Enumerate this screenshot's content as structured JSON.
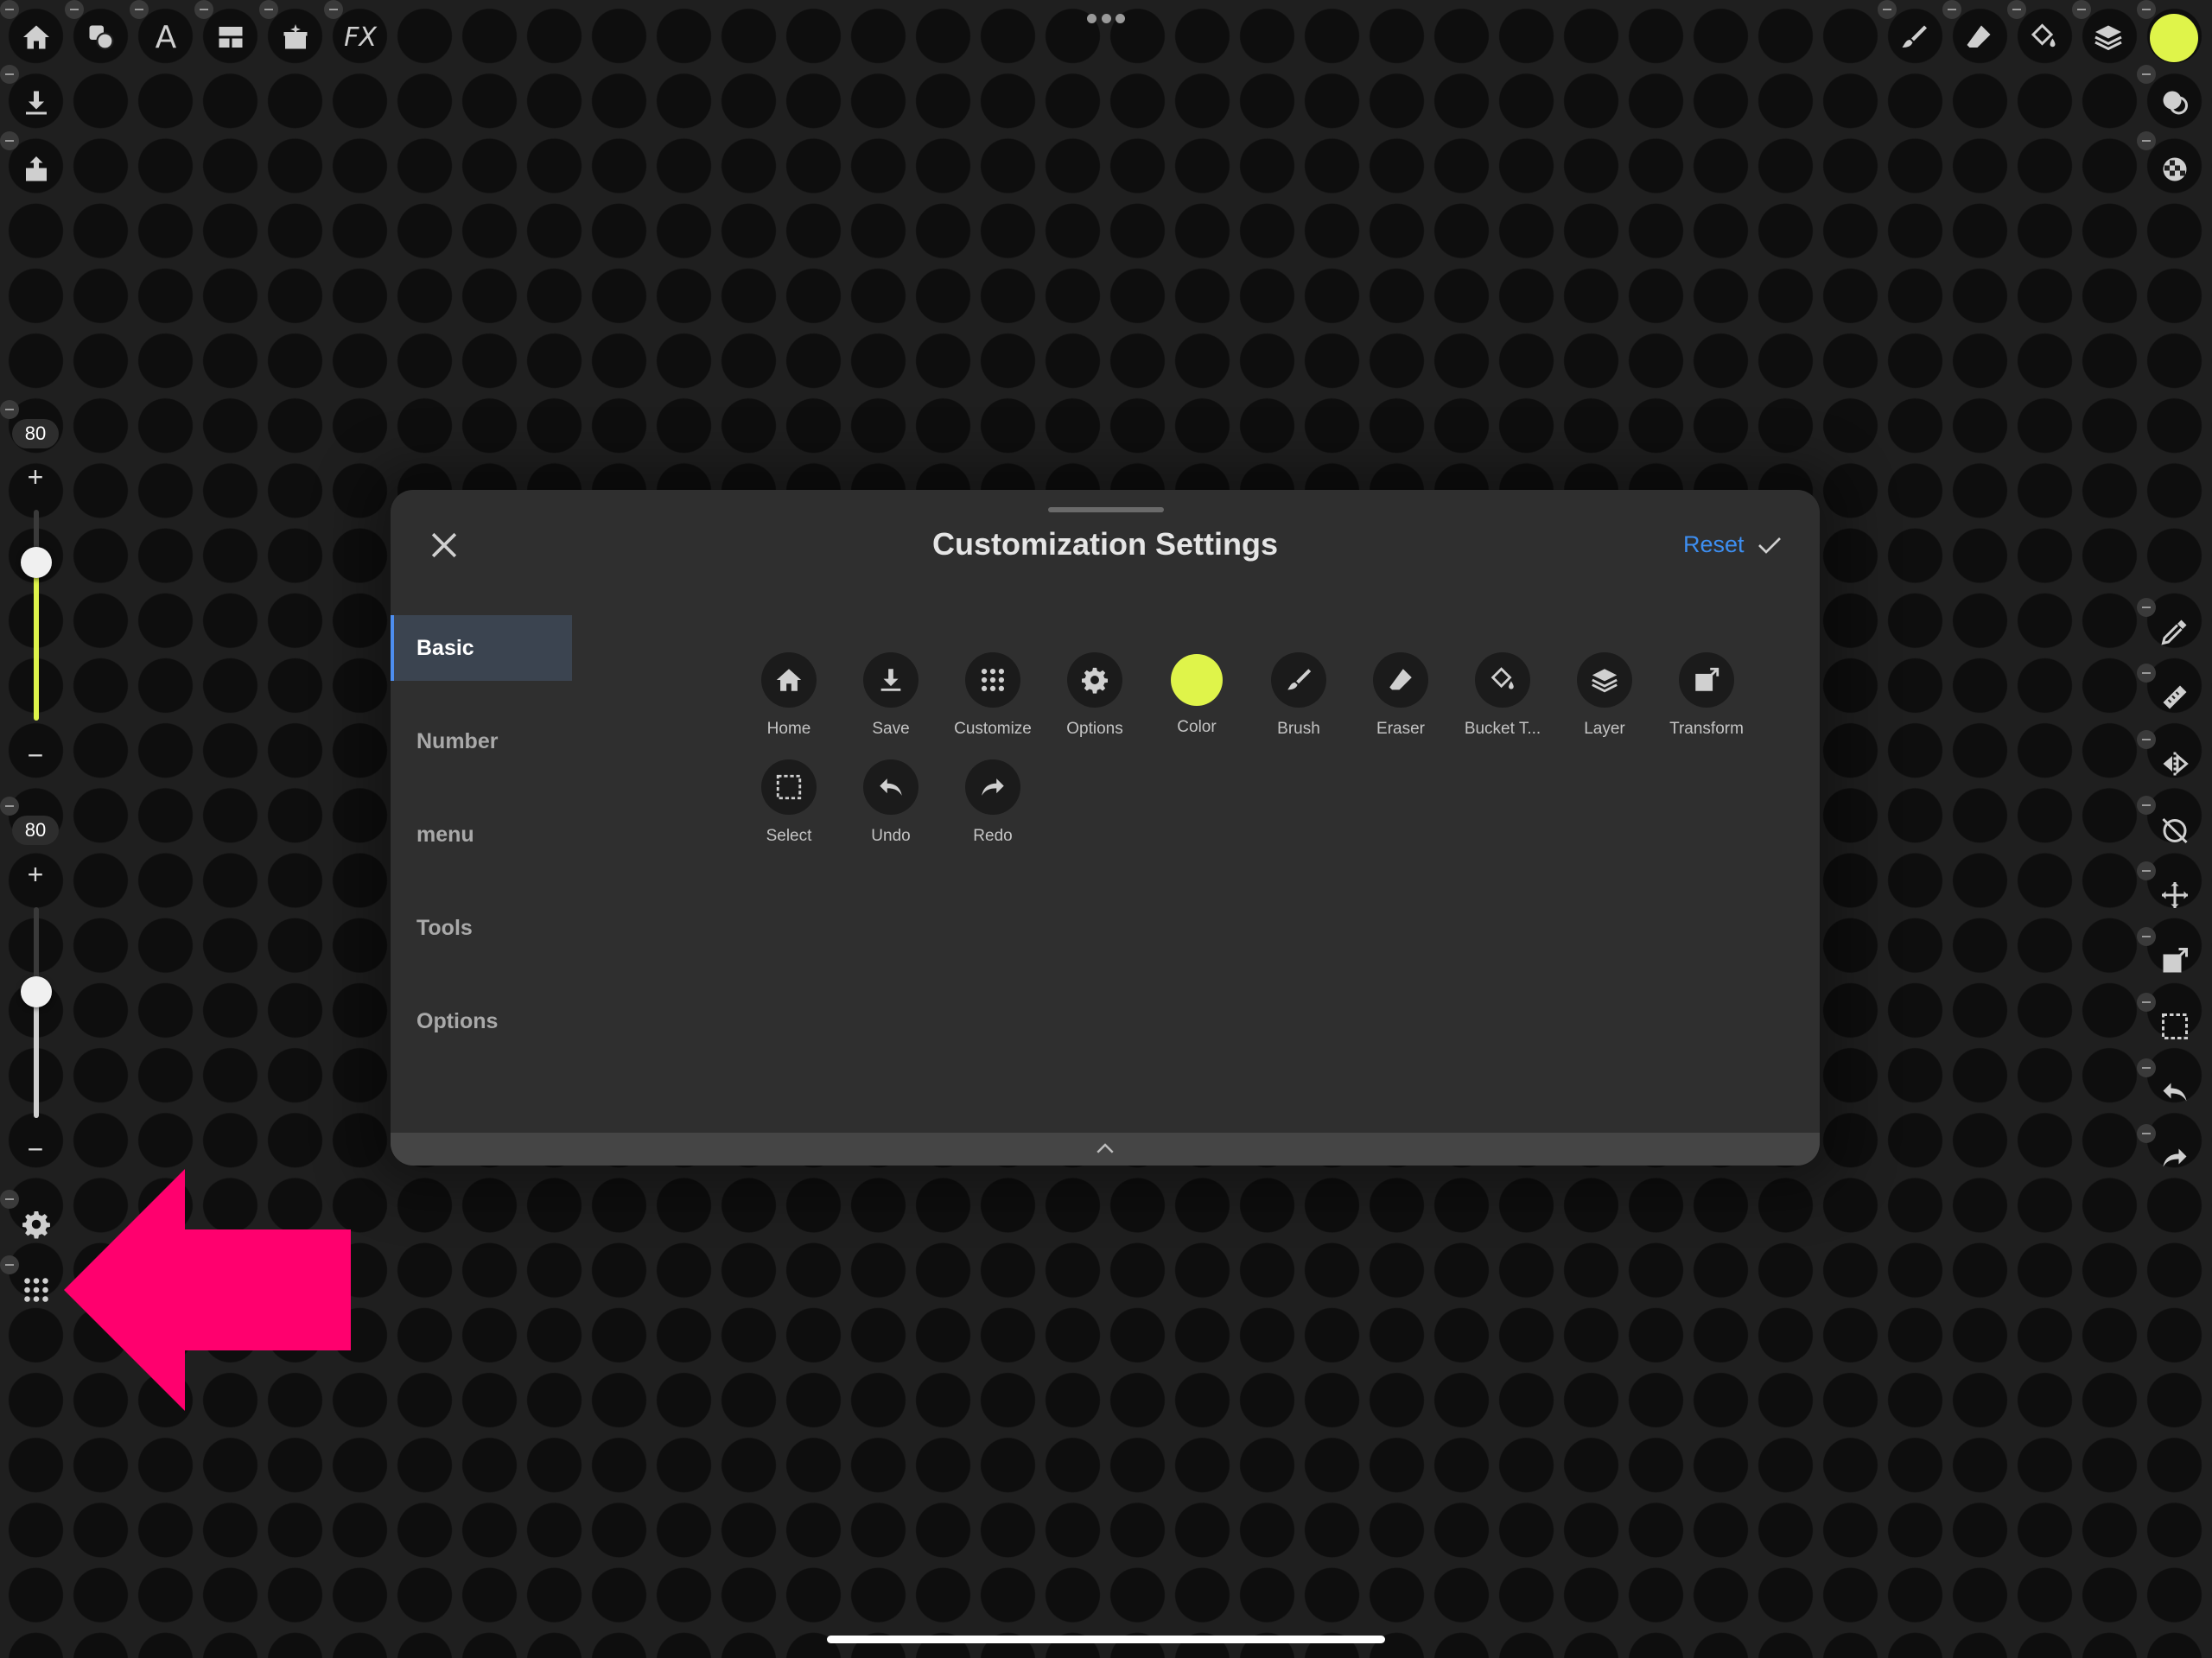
{
  "left_toolbar": {
    "size_slider": {
      "value": "80",
      "plus": "+",
      "minus": "−",
      "level": 0.75
    },
    "opacity_slider": {
      "value": "80",
      "plus": "+",
      "minus": "−",
      "level": 0.6
    }
  },
  "top_toolbar": {
    "text_tool": "A",
    "fx": "FX"
  },
  "colors": {
    "accent": "#dff44a",
    "link": "#3d8ef0",
    "dialog_bg": "#2f2f2f",
    "highlight_arrow": "#ff006e"
  },
  "dialog": {
    "title": "Customization Settings",
    "reset_label": "Reset",
    "sidebar": [
      "Basic",
      "Number",
      "menu",
      "Tools",
      "Options"
    ],
    "active_tab": "Basic",
    "tools": [
      {
        "label": "Home",
        "icon": "home-icon"
      },
      {
        "label": "Save",
        "icon": "download-icon"
      },
      {
        "label": "Customize",
        "icon": "grid-dots-icon"
      },
      {
        "label": "Options",
        "icon": "gear-icon"
      },
      {
        "label": "Color",
        "icon": "color-swatch-icon"
      },
      {
        "label": "Brush",
        "icon": "brush-icon"
      },
      {
        "label": "Eraser",
        "icon": "eraser-icon"
      },
      {
        "label": "Bucket T...",
        "icon": "bucket-icon"
      },
      {
        "label": "Layer",
        "icon": "layers-icon"
      },
      {
        "label": "Transform",
        "icon": "transform-icon"
      },
      {
        "label": "Select",
        "icon": "select-icon"
      },
      {
        "label": "Undo",
        "icon": "undo-icon"
      },
      {
        "label": "Redo",
        "icon": "redo-icon"
      }
    ]
  }
}
